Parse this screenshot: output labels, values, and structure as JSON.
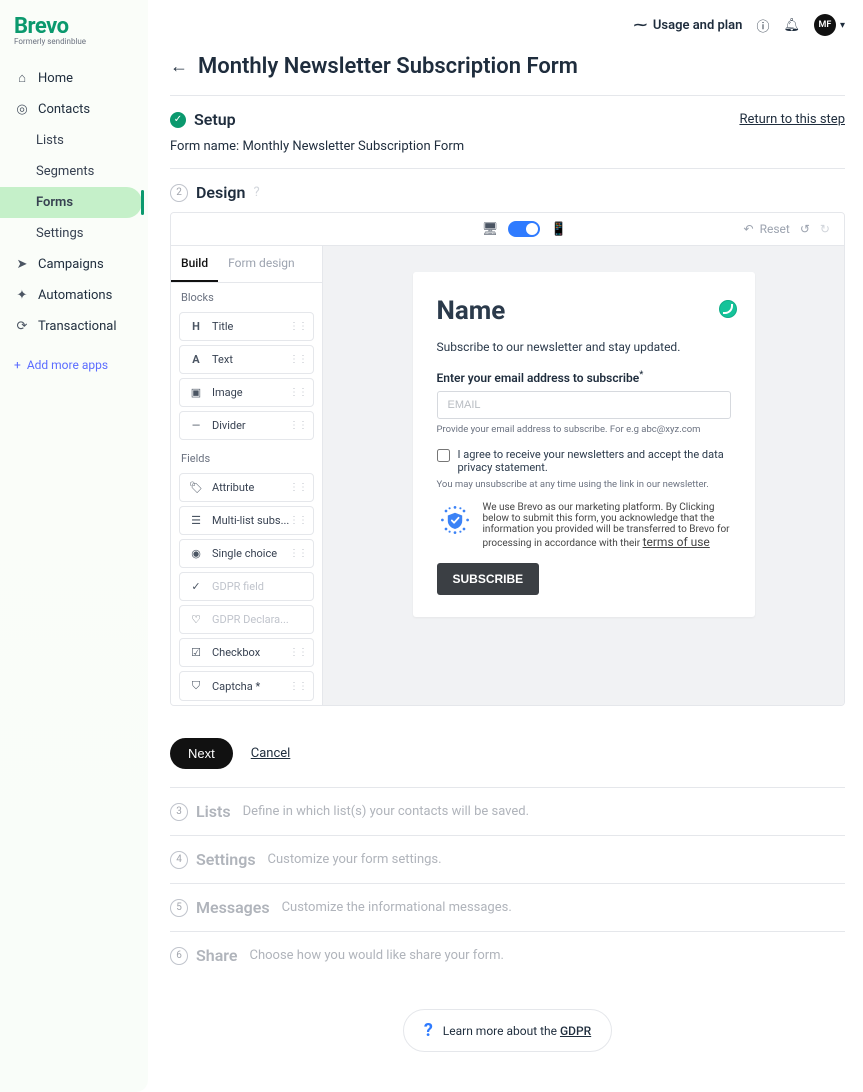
{
  "brand": {
    "name": "Brevo",
    "tagline": "Formerly sendinblue"
  },
  "sidebar": {
    "items": [
      {
        "label": "Home",
        "icon": "home-icon"
      },
      {
        "label": "Contacts",
        "icon": "contacts-icon"
      }
    ],
    "contacts_sub": [
      {
        "label": "Lists"
      },
      {
        "label": "Segments"
      },
      {
        "label": "Forms",
        "active": true
      },
      {
        "label": "Settings"
      }
    ],
    "items2": [
      {
        "label": "Campaigns",
        "icon": "send-icon"
      },
      {
        "label": "Automations",
        "icon": "automation-icon"
      },
      {
        "label": "Transactional",
        "icon": "repeat-icon"
      }
    ],
    "add_more": "Add more apps"
  },
  "topbar": {
    "usage": "Usage and plan",
    "avatar_initials": "MF"
  },
  "page": {
    "title": "Monthly Newsletter Subscription Form"
  },
  "setup": {
    "title": "Setup",
    "return": "Return to this step",
    "form_name_label": "Form name:",
    "form_name_value": "Monthly Newsletter Subscription Form"
  },
  "design": {
    "title": "Design",
    "toolbar": {
      "reset": "Reset"
    },
    "tabs": {
      "build": "Build",
      "form_design": "Form design"
    },
    "sections": {
      "blocks": {
        "label": "Blocks",
        "items": [
          "Title",
          "Text",
          "Image",
          "Divider"
        ]
      },
      "fields": {
        "label": "Fields",
        "items": [
          {
            "label": "Attribute",
            "disabled": false
          },
          {
            "label": "Multi-list subs...",
            "disabled": false
          },
          {
            "label": "Single choice",
            "disabled": false
          },
          {
            "label": "GDPR field",
            "disabled": true
          },
          {
            "label": "GDPR Declara...",
            "disabled": true
          },
          {
            "label": "Checkbox",
            "disabled": false
          },
          {
            "label": "Captcha *",
            "disabled": false
          }
        ]
      }
    },
    "preview": {
      "title": "Name",
      "subtitle": "Subscribe to our newsletter and stay updated.",
      "email_label": "Enter your email address to subscribe",
      "email_placeholder": "EMAIL",
      "email_help": "Provide your email address to subscribe. For e.g abc@xyz.com",
      "consent": "I agree to receive your newsletters and accept the data privacy statement.",
      "unsubscribe": "You may unsubscribe at any time using the link in our newsletter.",
      "brevo_notice": "We use Brevo as our marketing platform. By Clicking below to submit this form, you acknowledge that the information you provided will be transferred to Brevo for processing in accordance with their ",
      "terms": "terms of use",
      "subscribe": "SUBSCRIBE"
    }
  },
  "actions": {
    "next": "Next",
    "cancel": "Cancel"
  },
  "steps_future": [
    {
      "num": "3",
      "title": "Lists",
      "desc": "Define in which list(s) your contacts will be saved."
    },
    {
      "num": "4",
      "title": "Settings",
      "desc": "Customize your form settings."
    },
    {
      "num": "5",
      "title": "Messages",
      "desc": "Customize the informational messages."
    },
    {
      "num": "6",
      "title": "Share",
      "desc": "Choose how you would like share your form."
    }
  ],
  "gdpr": {
    "text": "Learn more about the ",
    "link": "GDPR"
  }
}
